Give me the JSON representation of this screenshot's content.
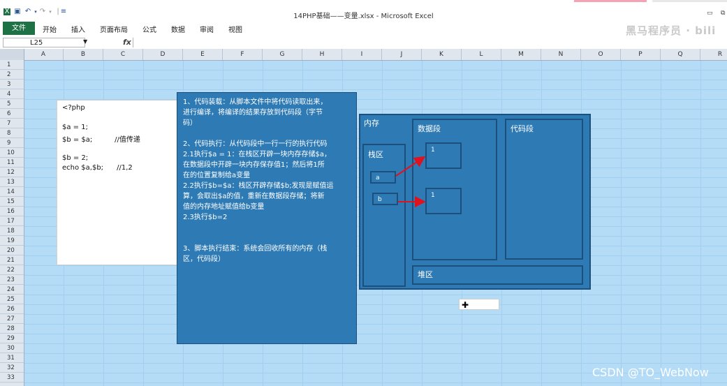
{
  "window": {
    "title": "14PHP基础——变量.xlsx - Microsoft Excel",
    "minimize_icon": "minimize-icon",
    "restore_icon": "restore-icon"
  },
  "ribbon": {
    "file_tab": "文件",
    "tabs": [
      "开始",
      "插入",
      "页面布局",
      "公式",
      "数据",
      "审阅",
      "视图"
    ],
    "watermark": "黑马程序员 · bili"
  },
  "formula_bar": {
    "name_box": "L25",
    "fx": "fx",
    "value": ""
  },
  "columns": [
    "A",
    "B",
    "C",
    "D",
    "E",
    "F",
    "G",
    "H",
    "I",
    "J",
    "K",
    "L",
    "M",
    "N",
    "O",
    "P",
    "Q",
    "R"
  ],
  "rows": [
    "1",
    "2",
    "3",
    "4",
    "5",
    "6",
    "7",
    "8",
    "9",
    "10",
    "11",
    "12",
    "13",
    "14",
    "15",
    "16",
    "17",
    "18",
    "19",
    "20",
    "21",
    "22",
    "23",
    "24",
    "25",
    "26",
    "27",
    "28",
    "29",
    "30",
    "31",
    "32",
    "33"
  ],
  "code_box": {
    "lines": [
      "<?php",
      "",
      "$a = 1;",
      "$b = $a;          //值传递",
      "",
      "$b = 2;",
      "echo $a,$b;      //1,2"
    ]
  },
  "explanation": {
    "lines": [
      "1、代码装载：从脚本文件中将代码读取出来，",
      "进行编译，将编译的结果存放到代码段（字节",
      "码）",
      "",
      "2、代码执行：从代码段中一行一行的执行代码",
      "2.1执行$a = 1：在栈区开辟一块内存存储$a，",
      "在数据段中开辟一块内存保存值1；然后将1所",
      "在的位置复制给a变量",
      "2.2执行$b=$a：栈区开辟存储$b;发现是赋值运",
      "算，会取出$a的值，重新在数据段存储；将新",
      "值的内存地址赋值给b变量",
      "2.3执行$b=2",
      "",
      "",
      "3、脚本执行结束：系统会回收所有的内存（栈",
      "区，代码段）"
    ]
  },
  "memory": {
    "title": "内存",
    "stack": "栈区",
    "data_segment": "数据段",
    "code_segment": "代码段",
    "heap": "堆区",
    "var_a": "a",
    "var_b": "b",
    "val_a": "1",
    "val_b": "1",
    "arrow_color": "#e0121e"
  },
  "watermark_bottom": "CSDN @TO_WebNow"
}
